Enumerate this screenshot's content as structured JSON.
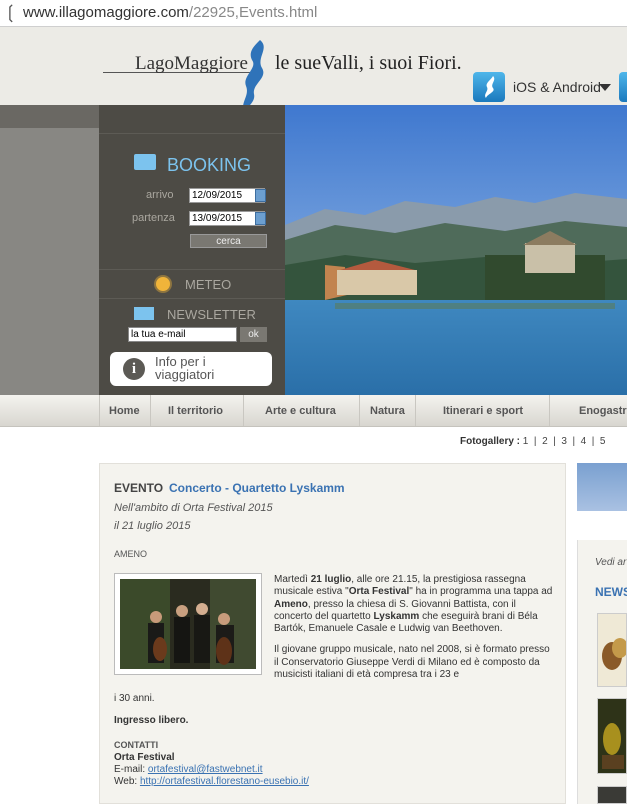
{
  "browser": {
    "url_host": "www.illagomaggiore.com",
    "url_path": "/22925,Events.html"
  },
  "header": {
    "logo": "LagoMaggiore",
    "tagline": "le sueValli, i suoi Fiori.",
    "app_label": "iOS & Android"
  },
  "booking": {
    "title": "BOOKING",
    "arrivo_label": "arrivo",
    "arrivo_value": "12/09/2015",
    "partenza_label": "partenza",
    "partenza_value": "13/09/2015",
    "search_label": "cerca",
    "meteo_label": "METEO",
    "newsletter_label": "NEWSLETTER",
    "email_placeholder": "la tua e-mail",
    "ok_label": "ok",
    "info_label": "Info per i viaggiatori"
  },
  "nav": {
    "items": [
      "Home",
      "Il territorio",
      "Arte e cultura",
      "Natura",
      "Itinerari e sport",
      "Enogastr"
    ]
  },
  "fotogallery": {
    "label": "Fotogallery :",
    "pages": [
      "1",
      "2",
      "3",
      "4",
      "5"
    ]
  },
  "article": {
    "evento_label": "EVENTO",
    "title": "Concerto - Quartetto Lyskamm",
    "context": "Nell'ambito di Orta Festival 2015",
    "date": "il 21 luglio 2015",
    "place": "AMENO",
    "p1_a": "Martedì ",
    "p1_b": "21 luglio",
    "p1_c": ", alle ore 21.15, la prestigiosa rassegna musicale estiva \"",
    "p1_d": "Orta Festival",
    "p1_e": "\" ha in programma una tappa ad ",
    "p1_f": "Ameno",
    "p1_g": ", presso la chiesa di S. Giovanni Battista, con il concerto del quartetto ",
    "p1_h": "Lyskamm",
    "p1_i": " che eseguirà brani di Béla Bartók, Emanuele Casale e Ludwig van Beethoven.",
    "p2": "Il giovane gruppo musicale, nato nel 2008, si è formato presso il Conservatorio Giuseppe Verdi di Milano ed è composto da musicisti italiani di età compresa tra i 23 e",
    "p2_tail": "i 30 anni.",
    "ingresso": "Ingresso libero.",
    "contatti_label": "CONTATTI",
    "contact_name": "Orta Festival",
    "email_label": "E-mail: ",
    "email": "ortafestival@fastwebnet.it",
    "web_label": "Web: ",
    "web": "http://ortafestival.florestano-eusebio.it/"
  },
  "right": {
    "vedi": "Vedi ar",
    "news": "NEWS"
  }
}
